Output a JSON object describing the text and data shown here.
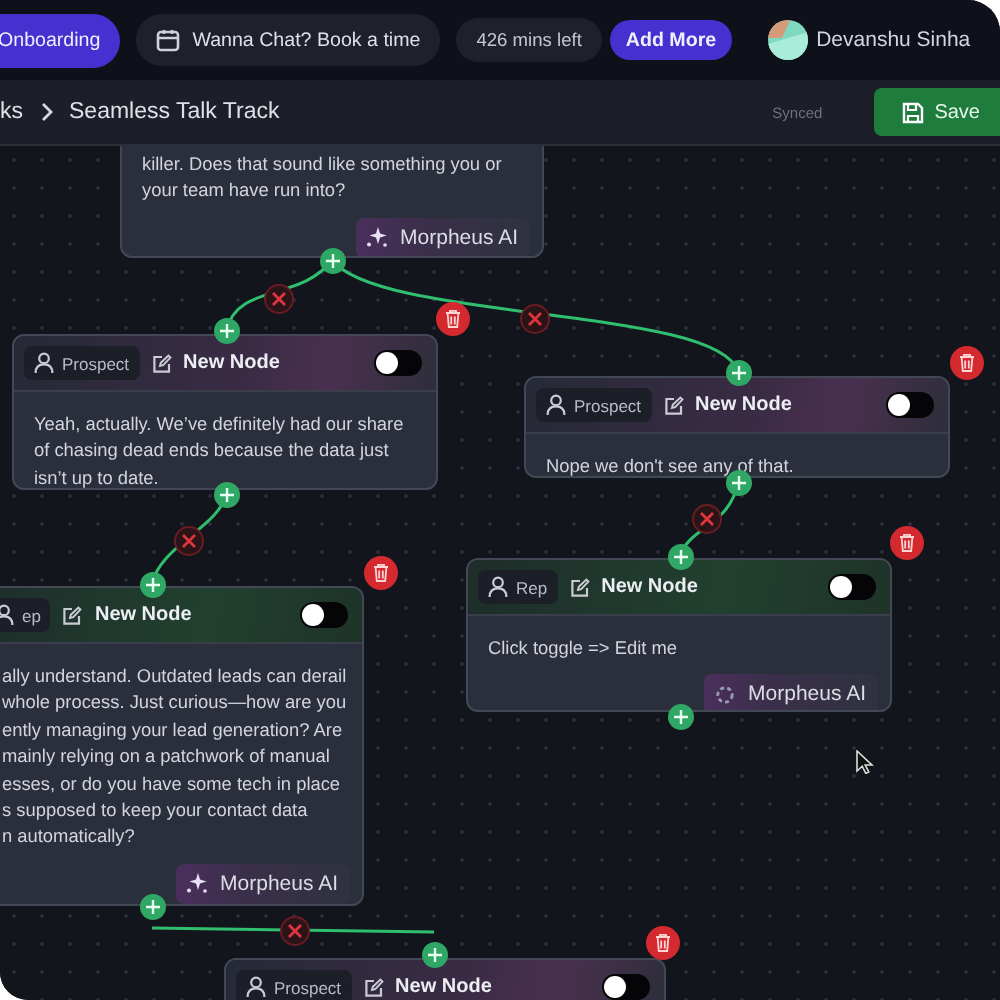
{
  "top_bar": {
    "onboarding_button": "Onboarding",
    "chat_button": "Wanna Chat? Book a time",
    "minutes_left": "426 mins left",
    "add_more_button": "Add More",
    "user_name": "Devanshu Sinha"
  },
  "breadcrumb": {
    "items": [
      {
        "label": "ks"
      },
      {
        "label": "Seamless Talk Track"
      }
    ],
    "status": "Synced",
    "save_button": "Save"
  },
  "nodes": [
    {
      "kind": "partial",
      "lines": [
        "killer. Does that sound like something you or",
        "your team have run into?"
      ],
      "ai_button": "Morpheus AI",
      "ai_loading": false
    },
    {
      "kind": "prospect",
      "role": "Prospect",
      "title": "New Node",
      "toggle_on": false,
      "lines": [
        "Yeah, actually. We’ve definitely had our share",
        "of chasing dead ends because the data just",
        "isn’t up to date."
      ]
    },
    {
      "kind": "prospect",
      "role": "Prospect",
      "title": "New Node",
      "toggle_on": false,
      "lines": [
        "Nope we don't see any of that."
      ]
    },
    {
      "kind": "rep",
      "role": "Rep",
      "title": "New Node",
      "toggle_on": false,
      "lines": [
        "Click toggle => Edit me"
      ],
      "ai_button": "Morpheus AI",
      "ai_loading": true
    },
    {
      "kind": "rep",
      "role": "ep",
      "title": "New Node",
      "toggle_on": false,
      "lines": [
        "ally understand. Outdated leads can derail",
        "whole process. Just curious—how are you",
        "ently managing your lead generation? Are",
        "mainly relying on a patchwork of manual",
        "esses, or do you have some tech in place",
        "s supposed to keep your contact data",
        "n automatically?"
      ],
      "ai_button": "Morpheus AI",
      "ai_loading": false
    },
    {
      "kind": "prospect",
      "role": "Prospect",
      "title": "New Node",
      "toggle_on": false
    }
  ]
}
